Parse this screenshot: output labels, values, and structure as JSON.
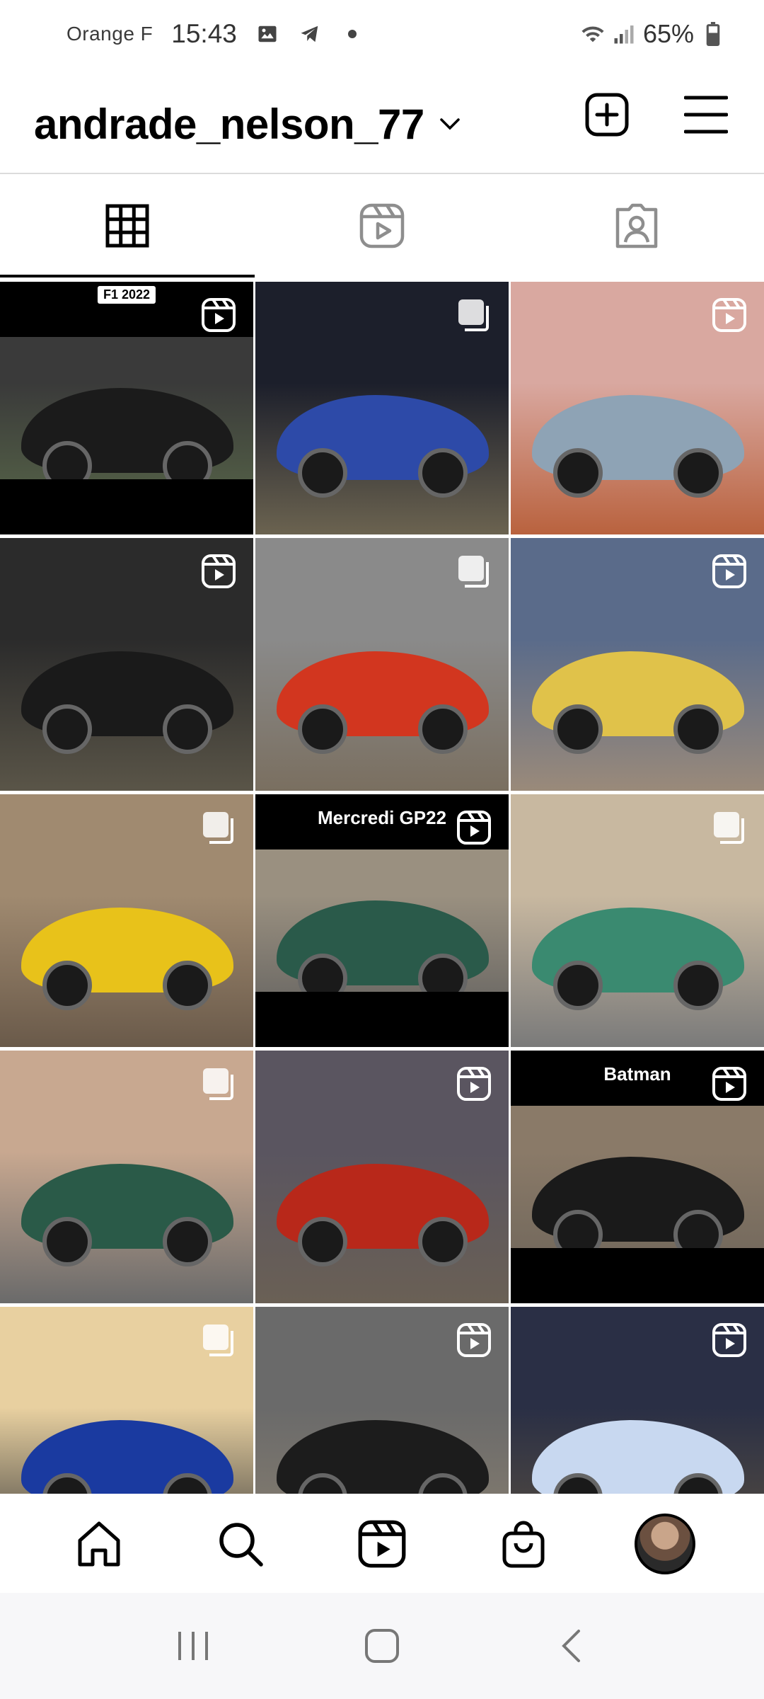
{
  "status_bar": {
    "carrier": "Orange F",
    "time": "15:43",
    "battery": "65%",
    "icons_left": [
      "image-icon",
      "telegram-icon",
      "dot-icon"
    ],
    "icons_right": [
      "wifi-icon",
      "signal-icon",
      "battery-icon"
    ]
  },
  "header": {
    "username": "andrade_nelson_77",
    "actions": [
      "create-icon",
      "menu-icon"
    ]
  },
  "tabs": [
    {
      "name": "posts",
      "icon": "grid-icon",
      "active": true
    },
    {
      "name": "reels",
      "icon": "reels-icon",
      "active": false
    },
    {
      "name": "tagged",
      "icon": "tagged-icon",
      "active": false
    }
  ],
  "grid": [
    {
      "type": "reel",
      "label": "F1 2022",
      "bands": true,
      "colors": [
        "#3a3a3a",
        "#1b1b1b",
        "#5b6b4a"
      ]
    },
    {
      "type": "carousel",
      "colors": [
        "#1c1f2b",
        "#2d4aa8",
        "#6b6350"
      ]
    },
    {
      "type": "reel",
      "colors": [
        "#d9a8a0",
        "#8ea3b5",
        "#b9623e"
      ]
    },
    {
      "type": "reel",
      "colors": [
        "#2b2b2b",
        "#1a1a1a",
        "#5a5548"
      ]
    },
    {
      "type": "carousel",
      "colors": [
        "#8a8a8a",
        "#d2361f",
        "#7a6f60"
      ]
    },
    {
      "type": "reel",
      "colors": [
        "#5a6b8a",
        "#e0c24a",
        "#9a8a7a"
      ]
    },
    {
      "type": "carousel",
      "colors": [
        "#a08a70",
        "#e8c21a",
        "#6a5a4a"
      ]
    },
    {
      "type": "reel",
      "label": "Mercredi GP22",
      "bands": true,
      "colors": [
        "#9a9080",
        "#2a5a4a",
        "#5a5a5a"
      ]
    },
    {
      "type": "carousel",
      "colors": [
        "#c8b8a0",
        "#3a8a70",
        "#7a7a7a"
      ]
    },
    {
      "type": "carousel",
      "colors": [
        "#c8a890",
        "#2a5a48",
        "#6a6a6a"
      ]
    },
    {
      "type": "reel",
      "colors": [
        "#5a5560",
        "#b8281a",
        "#6a6055"
      ]
    },
    {
      "type": "reel",
      "label": "Batman",
      "bands": true,
      "colors": [
        "#8a7a68",
        "#1a1a1a",
        "#6a6258"
      ]
    },
    {
      "type": "carousel",
      "colors": [
        "#e8d0a0",
        "#1a3aa0",
        "#3a3a3a"
      ]
    },
    {
      "type": "reel",
      "colors": [
        "#6a6a6a",
        "#1c1c1c",
        "#8a8070"
      ]
    },
    {
      "type": "reel",
      "colors": [
        "#2a2f45",
        "#c8d8f0",
        "#5a5040"
      ]
    }
  ],
  "bottom_nav": [
    "home-icon",
    "search-icon",
    "reels-icon",
    "shop-icon",
    "profile-avatar"
  ],
  "system_nav": [
    "recent-apps-icon",
    "home-button-icon",
    "back-icon"
  ]
}
